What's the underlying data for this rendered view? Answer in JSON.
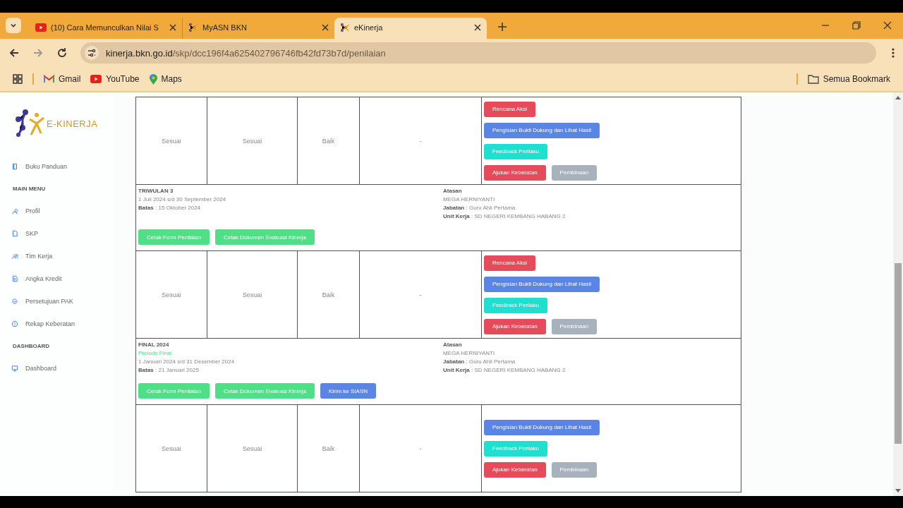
{
  "browser": {
    "tabs": [
      {
        "title": "(10) Cara Memunculkan Nilai S",
        "kind": "video",
        "selected": false
      },
      {
        "title": "MyASN BKN",
        "kind": "site",
        "selected": false
      },
      {
        "title": "eKinerja",
        "kind": "site",
        "selected": true
      }
    ],
    "url_host": "kinerja.bkn.go.id",
    "url_path": "/skp/dcc196f4a625402796746fb42fd73b7d/penilaian",
    "bookmarks": [
      {
        "label": "Gmail",
        "kind": "mail"
      },
      {
        "label": "YouTube",
        "kind": "video"
      },
      {
        "label": "Maps",
        "kind": "pin"
      }
    ],
    "all_bookmarks": "Semua Bookmark"
  },
  "sidebar": {
    "logo_title": "E-KINERJA",
    "items": [
      {
        "label": "Buku Panduan",
        "kind": "link"
      },
      {
        "label": "MAIN MENU",
        "kind": "section"
      },
      {
        "label": "Profil",
        "kind": "link"
      },
      {
        "label": "SKP",
        "kind": "link"
      },
      {
        "label": "Tim Kerja",
        "kind": "link"
      },
      {
        "label": "Angka Kredit",
        "kind": "link"
      },
      {
        "label": "Persetujuan PAK",
        "kind": "link"
      },
      {
        "label": "Rekap Keberatan",
        "kind": "link"
      },
      {
        "label": "DASHBOARD",
        "kind": "section"
      },
      {
        "label": "Dashboard",
        "kind": "link"
      }
    ]
  },
  "table": {
    "rows": [
      {
        "kind": "scores",
        "cells": [
          "Sesuai",
          "Sesuai",
          "Baik",
          "-"
        ],
        "actions": [
          [
            {
              "label": "Rencana Aksi",
              "kind": "danger"
            }
          ],
          [
            {
              "label": "Pengisian Bukti Dukung dan Lihat Hasil",
              "kind": "primary"
            }
          ],
          [
            {
              "label": "Feedback Perilaku",
              "kind": "info"
            }
          ],
          [
            {
              "label": "Ajukan Keberatan",
              "kind": "danger"
            },
            {
              "label": "Pembinaan",
              "kind": "secondary"
            }
          ]
        ]
      },
      {
        "kind": "period",
        "title": "TRIWULAN 3",
        "dates": "1 Juli 2024 s/d 30 September 2024",
        "batas_label": "Batas",
        "batas": ": 15 Oktober 2024",
        "atasan_label": "Atasan",
        "atasan_name": "MEGA HERNIYANTI",
        "jabatan_label": "Jabatan",
        "jabatan": ": Guru Ahli Pertama",
        "unit_label": "Unit Kerja",
        "unit": ": SD NEGERI KEMBANG HABANG 2",
        "buttons": [
          {
            "label": "Cetak Form Penilaian",
            "kind": "success"
          },
          {
            "label": "Cetak Dokumen Evaluasi Kinerja",
            "kind": "success"
          }
        ]
      },
      {
        "kind": "scores",
        "cells": [
          "Sesuai",
          "Sesuai",
          "Baik",
          "-"
        ],
        "actions": [
          [
            {
              "label": "Rencana Aksi",
              "kind": "danger"
            }
          ],
          [
            {
              "label": "Pengisian Bukti Dukung dan Lihat Hasil",
              "kind": "primary"
            }
          ],
          [
            {
              "label": "Feedback Perilaku",
              "kind": "info"
            }
          ],
          [
            {
              "label": "Ajukan Keberatan",
              "kind": "danger"
            },
            {
              "label": "Pembinaan",
              "kind": "secondary"
            }
          ]
        ]
      },
      {
        "kind": "period",
        "title": "FINAL 2024",
        "subtitle": "Periode Final",
        "dates": "1 Januari 2024 s/d 31 Desember 2024",
        "batas_label": "Batas",
        "batas": ": 21 Januari 2025",
        "atasan_label": "Atasan",
        "atasan_name": "MEGA HERNIYANTI",
        "jabatan_label": "Jabatan",
        "jabatan": ": Guru Ahli Pertama",
        "unit_label": "Unit Kerja",
        "unit": ": SD NEGERI KEMBANG HABANG 2",
        "buttons": [
          {
            "label": "Cetak Form Penilaian",
            "kind": "success"
          },
          {
            "label": "Cetak Dokumen Evaluasi Kinerja",
            "kind": "success"
          },
          {
            "label": "Kirim ke SIASN",
            "kind": "primary"
          }
        ]
      },
      {
        "kind": "scores",
        "cells": [
          "Sesuai",
          "Sesuai",
          "Baik",
          "-"
        ],
        "actions": [
          [
            {
              "label": "Pengisian Bukti Dukung dan Lihat Hasil",
              "kind": "primary"
            }
          ],
          [
            {
              "label": "Feedback Perilaku",
              "kind": "info"
            }
          ],
          [
            {
              "label": "Ajukan Keberatan",
              "kind": "danger"
            },
            {
              "label": "Pembinaan",
              "kind": "secondary"
            }
          ]
        ]
      }
    ]
  }
}
